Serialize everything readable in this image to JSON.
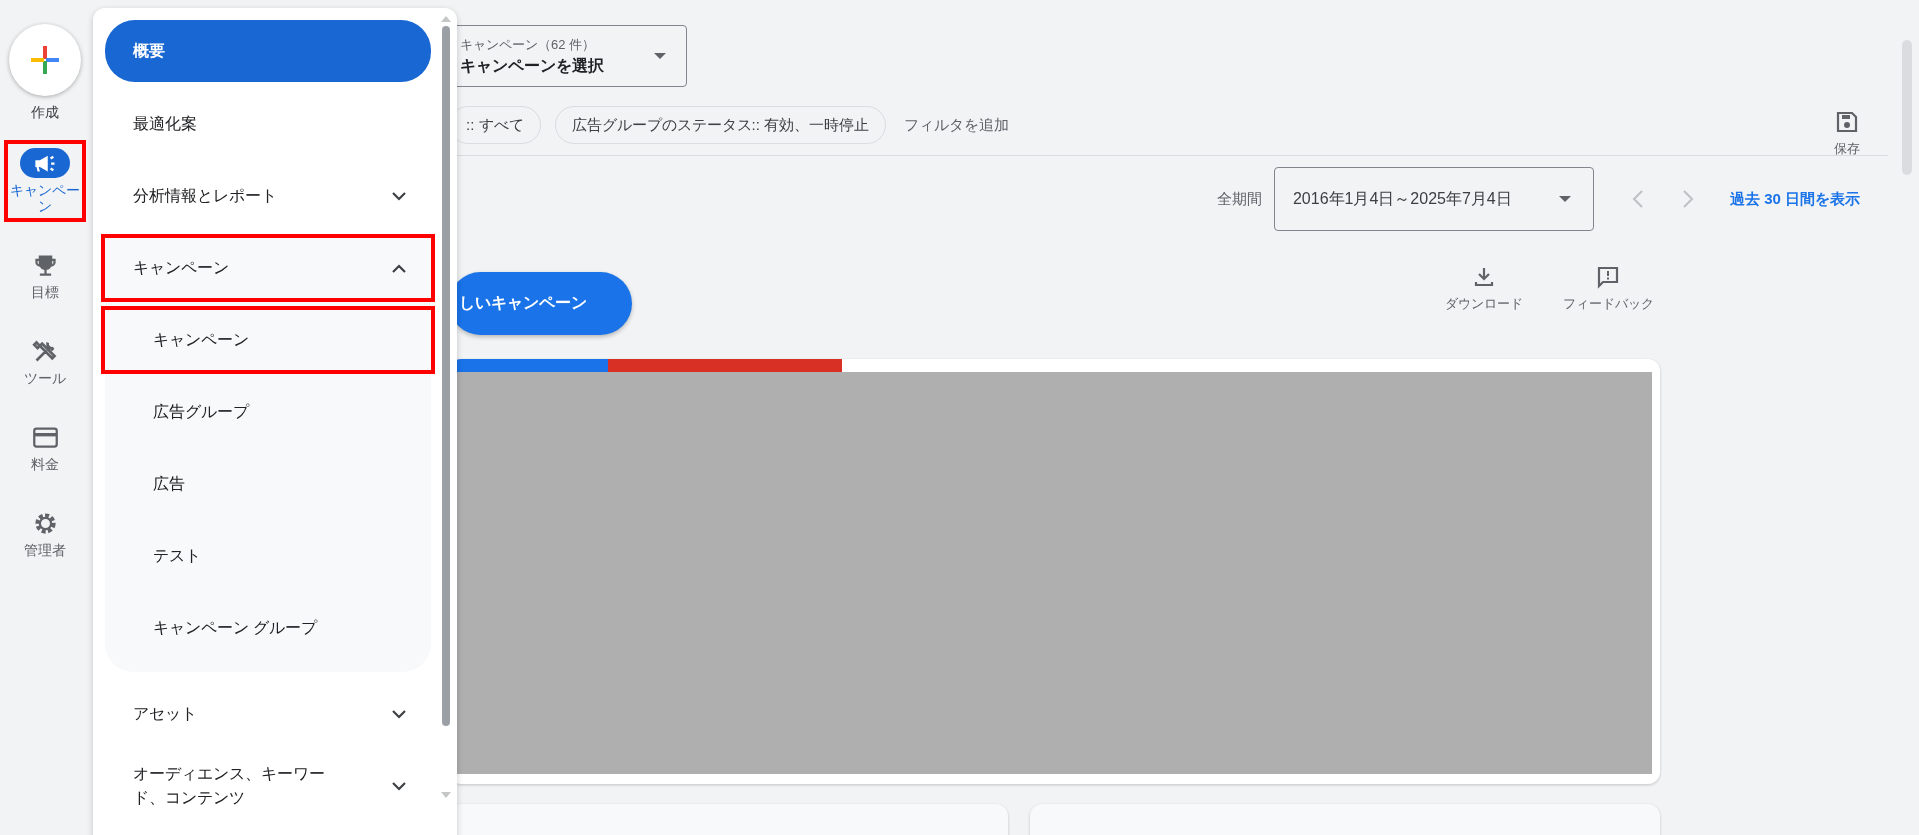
{
  "rail": {
    "create": {
      "label": "作成"
    },
    "items": [
      {
        "kind": "campaign",
        "label": "キャンペーン",
        "selected": true,
        "highlighted": true
      },
      {
        "kind": "goals",
        "label": "目標",
        "selected": false,
        "highlighted": false
      },
      {
        "kind": "tools",
        "label": "ツール",
        "selected": false,
        "highlighted": false
      },
      {
        "kind": "billing",
        "label": "料金",
        "selected": false,
        "highlighted": false
      },
      {
        "kind": "admin",
        "label": "管理者",
        "selected": false,
        "highlighted": false
      }
    ]
  },
  "nav_menu": {
    "items": [
      {
        "label": "概要",
        "selected": true,
        "highlighted": false
      },
      {
        "label": "最適化案",
        "selected": false,
        "highlighted": false
      },
      {
        "label": "分析情報とレポート",
        "selected": false,
        "highlighted": false,
        "expanded": false
      },
      {
        "label": "キャンペーン",
        "selected": false,
        "highlighted": true,
        "expanded": true,
        "children": [
          {
            "label": "キャンペーン",
            "selected": false,
            "highlighted": true
          },
          {
            "label": "広告グループ",
            "selected": false,
            "highlighted": false
          },
          {
            "label": "広告",
            "selected": false,
            "highlighted": false
          },
          {
            "label": "テスト",
            "selected": false,
            "highlighted": false
          },
          {
            "label": "キャンペーン グループ",
            "selected": false,
            "highlighted": false
          }
        ]
      },
      {
        "label": "アセット",
        "selected": false,
        "highlighted": false,
        "expanded": false
      },
      {
        "label": "オーディエンス、キーワード、コンテンツ",
        "selected": false,
        "highlighted": false,
        "expanded": false
      }
    ]
  },
  "campaign_selector": {
    "label": "キャンペーン（62 件）",
    "value": "キャンペーンを選択"
  },
  "filters": [
    ":: すべて",
    "広告グループのステータス:: 有効、一時停止"
  ],
  "add_filter": "フィルタを追加",
  "save": "保存",
  "date_range": {
    "label": "全期間",
    "value": "2016年1月4日～2025年7月4日"
  },
  "show_last_30": "過去 30 日間を表示",
  "new_campaign_button": "しいキャンペーン",
  "actions": [
    {
      "kind": "download",
      "label": "ダウンロード"
    },
    {
      "kind": "feedback",
      "label": "フィードバック"
    }
  ]
}
